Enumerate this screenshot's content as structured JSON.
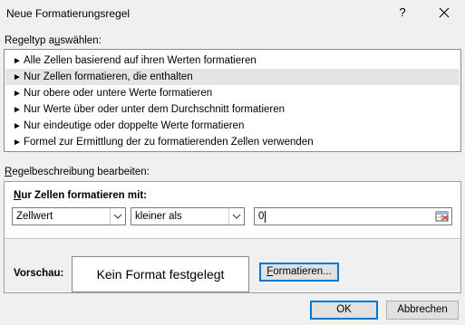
{
  "window": {
    "title": "Neue Formatierungsregel",
    "help_label": "?"
  },
  "rule_type": {
    "label_before": "Regeltyp a",
    "label_accel": "u",
    "label_after": "swählen:",
    "items": [
      {
        "label": "Alle Zellen basierend auf ihren Werten formatieren",
        "selected": false
      },
      {
        "label": "Nur Zellen formatieren, die enthalten",
        "selected": true
      },
      {
        "label": "Nur obere oder untere Werte formatieren",
        "selected": false
      },
      {
        "label": "Nur Werte über oder unter dem Durchschnitt formatieren",
        "selected": false
      },
      {
        "label": "Nur eindeutige oder doppelte Werte formatieren",
        "selected": false
      },
      {
        "label": "Formel zur Ermittlung der zu formatierenden Zellen verwenden",
        "selected": false
      }
    ]
  },
  "description": {
    "label_before": "",
    "label_accel": "R",
    "label_after": "egelbeschreibung bearbeiten:",
    "sub_accel": "N",
    "sub_after": "ur Zellen formatieren mit:",
    "condition_field": "Zellwert",
    "operator": "kleiner als",
    "value": "0",
    "preview_label": "Vorschau:",
    "preview_text": "Kein Format festgelegt",
    "format_accel": "F",
    "format_after": "ormatieren..."
  },
  "buttons": {
    "ok": "OK",
    "cancel": "Abbrechen"
  },
  "colors": {
    "selected_row": "#e5e5e5",
    "focus_border": "#0078d4",
    "dialog_bg": "#f0f0f0"
  }
}
